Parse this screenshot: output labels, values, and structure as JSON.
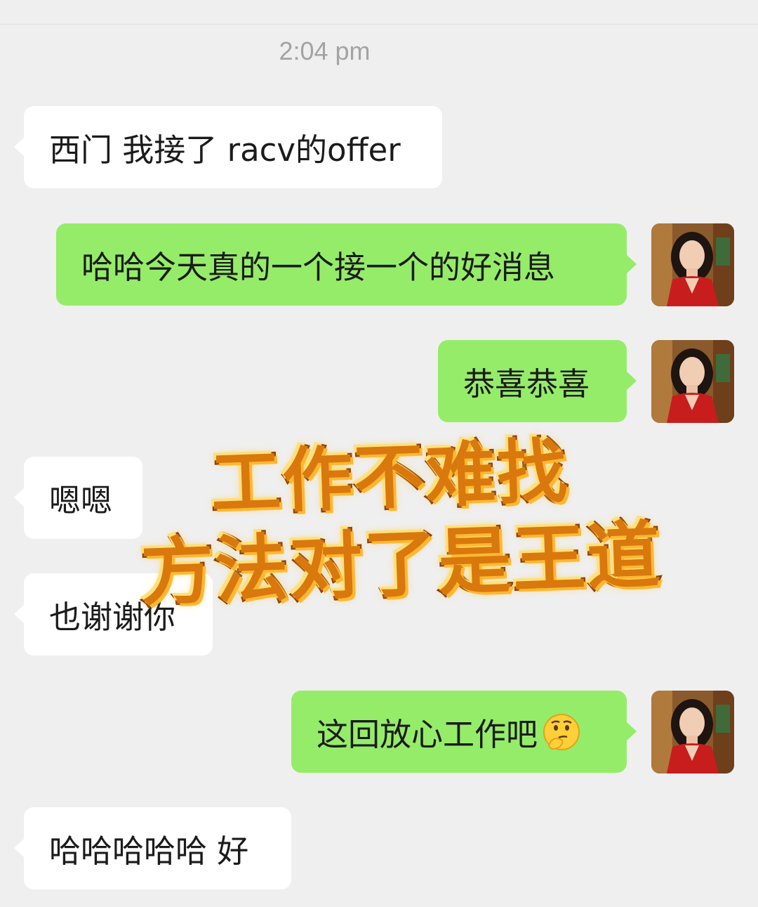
{
  "chat": {
    "timestamp": "2:04 pm",
    "messages": [
      {
        "side": "in",
        "text": "西门 我接了 racv的offer"
      },
      {
        "side": "out",
        "text": "哈哈今天真的一个接一个的好消息"
      },
      {
        "side": "out",
        "text": "恭喜恭喜"
      },
      {
        "side": "in",
        "text": "嗯嗯"
      },
      {
        "side": "in",
        "text": "也谢谢你"
      },
      {
        "side": "out",
        "text": "这回放心工作吧",
        "emoji": "thinking-face-emoji"
      },
      {
        "side": "in",
        "text": "哈哈哈哈哈 好"
      }
    ]
  },
  "overlay": {
    "line1": "工作不难找",
    "line2": "方法对了是王道"
  },
  "colors": {
    "background": "#efefef",
    "incoming_bubble": "#ffffff",
    "outgoing_bubble": "#95ec69",
    "timestamp": "#a3a3a3",
    "overlay_fill": "#d9780d",
    "overlay_stroke": "#7a2a05"
  }
}
